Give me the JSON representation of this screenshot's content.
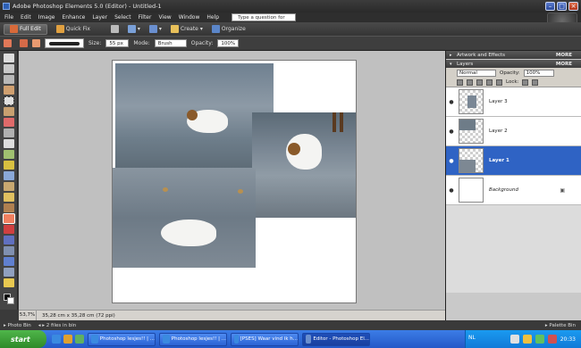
{
  "window": {
    "title": "Adobe Photoshop Elements 5.0 (Editor) - Untitled-1"
  },
  "menu": {
    "items": [
      "File",
      "Edit",
      "Image",
      "Enhance",
      "Layer",
      "Select",
      "Filter",
      "View",
      "Window",
      "Help"
    ],
    "help_placeholder": "Type a question for help"
  },
  "shortcuts": {
    "full_edit": "Full Edit",
    "quick_fix": "Quick Fix",
    "create": "Create",
    "organize": "Organize"
  },
  "options": {
    "size_label": "Size:",
    "size_value": "55 px",
    "mode_label": "Mode:",
    "mode_value": "Brush",
    "opacity_label": "Opacity:",
    "opacity_value": "100%"
  },
  "status": {
    "zoom": "53,7%",
    "doc_info": "35,28 cm x 35,28 cm (72 ppi)"
  },
  "photobin": {
    "label": "Photo Bin",
    "files": "2 files in bin",
    "palette_bin": "Palette Bin"
  },
  "palettes": {
    "artwork": "Artwork and Effects",
    "layers": "Layers",
    "more": "MORE",
    "blend_mode": "Normal",
    "opacity_label": "Opacity:",
    "opacity_value": "100%",
    "lock_label": "Lock:",
    "layers_list": [
      {
        "name": "Layer 3",
        "active": false
      },
      {
        "name": "Layer 2",
        "active": false
      },
      {
        "name": "Layer 1",
        "active": true
      },
      {
        "name": "Background",
        "active": false
      }
    ]
  },
  "taskbar": {
    "start": "start",
    "tasks": [
      "Photoshop lesjes!! | ...",
      "Photoshop lesjes!! | ...",
      "[PSES] Waar vind ik h...",
      "Editor - Photoshop El..."
    ],
    "language": "NL",
    "clock": "20:33"
  }
}
